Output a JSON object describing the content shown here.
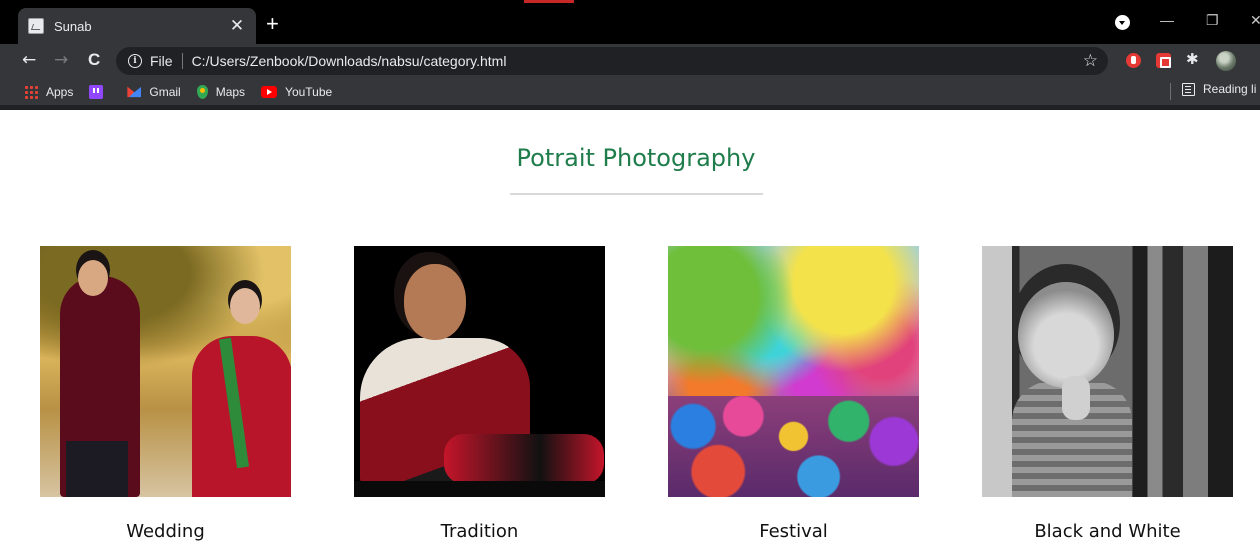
{
  "browser": {
    "tab": {
      "title": "Sunab",
      "close": "✕"
    },
    "new_tab": "+",
    "window": {
      "minimize": "—",
      "restore": "❐",
      "close": "✕"
    },
    "nav": {
      "back": "←",
      "forward": "→",
      "reload": "C"
    },
    "address": {
      "scheme": "File",
      "url": "C:/Users/Zenbook/Downloads/nabsu/category.html"
    },
    "star": "☆",
    "puzzle": "✱",
    "bookmarks": [
      {
        "label": "Apps",
        "icon": "apps-icon"
      },
      {
        "label": "",
        "icon": "twitch-icon"
      },
      {
        "label": "Gmail",
        "icon": "gmail-icon"
      },
      {
        "label": "Maps",
        "icon": "maps-icon"
      },
      {
        "label": "YouTube",
        "icon": "youtube-icon"
      }
    ],
    "reading_list": "Reading li",
    "colors": {
      "tabstrip": "#000000",
      "toolbar": "#35363a",
      "omnibox": "#202124",
      "text": "#e8eaed"
    }
  },
  "page": {
    "heading": "Potrait Photography",
    "heading_color": "#1e7d4a",
    "categories": [
      {
        "label": "Wedding"
      },
      {
        "label": "Tradition"
      },
      {
        "label": "Festival"
      },
      {
        "label": "Black and White"
      }
    ]
  }
}
